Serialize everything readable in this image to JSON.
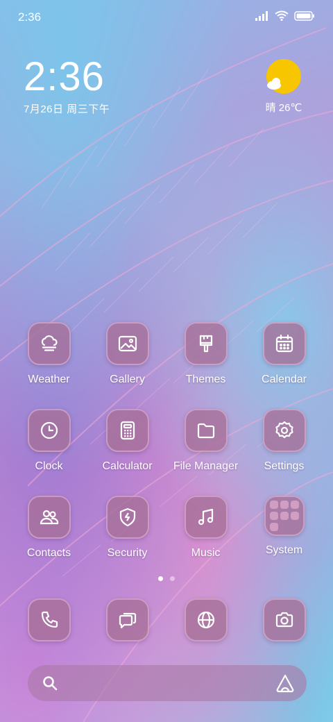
{
  "status_bar": {
    "time": "2:36",
    "icons": [
      "signal-icon",
      "wifi-icon",
      "battery-icon"
    ]
  },
  "clock_widget": {
    "time": "2:36",
    "date": "7月26日 周三下午"
  },
  "weather_widget": {
    "icon": "partly-sunny-icon",
    "text": "晴 26℃"
  },
  "apps": [
    {
      "label": "Weather",
      "icon": "weather-cloud-icon"
    },
    {
      "label": "Gallery",
      "icon": "gallery-icon"
    },
    {
      "label": "Themes",
      "icon": "themes-brush-icon"
    },
    {
      "label": "Calendar",
      "icon": "calendar-icon"
    },
    {
      "label": "Clock",
      "icon": "clock-icon"
    },
    {
      "label": "Calculator",
      "icon": "calculator-icon"
    },
    {
      "label": "File Manager",
      "icon": "folder-icon"
    },
    {
      "label": "Settings",
      "icon": "gear-icon"
    },
    {
      "label": "Contacts",
      "icon": "contacts-icon"
    },
    {
      "label": "Security",
      "icon": "shield-icon"
    },
    {
      "label": "Music",
      "icon": "music-note-icon"
    },
    {
      "label": "System",
      "icon": "folder-group-icon"
    }
  ],
  "page_indicator": {
    "pages": 2,
    "current": 1
  },
  "dock": [
    {
      "icon": "phone-icon"
    },
    {
      "icon": "messages-icon"
    },
    {
      "icon": "browser-globe-icon"
    },
    {
      "icon": "camera-icon"
    }
  ],
  "search_bar": {
    "left_icon": "search-icon",
    "right_icon": "assistant-icon"
  },
  "colors": {
    "icon_tile": "#a56e96",
    "sun": "#f7c600",
    "text": "#ffffff"
  }
}
